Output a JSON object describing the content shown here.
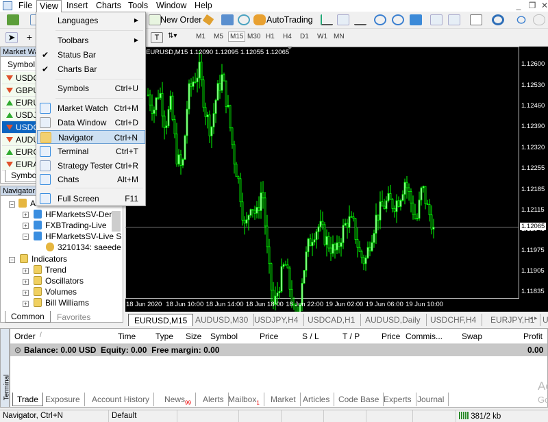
{
  "menubar": {
    "items": [
      "File",
      "View",
      "Insert",
      "Charts",
      "Tools",
      "Window",
      "Help"
    ]
  },
  "toolbar": {
    "new_order": "New Order",
    "autotrading": "AutoTrading",
    "timeframes": [
      "M1",
      "M5",
      "M15",
      "M30",
      "H1",
      "H4",
      "D1",
      "W1",
      "MN"
    ],
    "active_timeframe": "M15"
  },
  "view_menu": {
    "items": [
      {
        "label": "Languages",
        "shortcut": "",
        "submenu": true
      },
      {
        "label": "Toolbars",
        "shortcut": "",
        "submenu": true
      },
      {
        "label": "Status Bar",
        "shortcut": "",
        "checked": true
      },
      {
        "label": "Charts Bar",
        "shortcut": "",
        "checked": true
      },
      {
        "label": "Symbols",
        "shortcut": "Ctrl+U"
      },
      {
        "label": "Market Watch",
        "shortcut": "Ctrl+M"
      },
      {
        "label": "Data Window",
        "shortcut": "Ctrl+D"
      },
      {
        "label": "Navigator",
        "shortcut": "Ctrl+N",
        "highlighted": true
      },
      {
        "label": "Terminal",
        "shortcut": "Ctrl+T"
      },
      {
        "label": "Strategy Tester",
        "shortcut": "Ctrl+R"
      },
      {
        "label": "Chats",
        "shortcut": "Alt+M"
      },
      {
        "label": "Full Screen",
        "shortcut": "F11"
      }
    ]
  },
  "market_watch": {
    "title": "Market Watch",
    "column": "Symbol",
    "tab": "Symbols",
    "rows": [
      {
        "symbol": "USDCHF",
        "dir": "down"
      },
      {
        "symbol": "GBPUSD",
        "dir": "down"
      },
      {
        "symbol": "EURUSD",
        "dir": "up"
      },
      {
        "symbol": "USDJPY",
        "dir": "up"
      },
      {
        "symbol": "USDCAD",
        "dir": "down",
        "selected": true
      },
      {
        "symbol": "AUDUSD",
        "dir": "down"
      },
      {
        "symbol": "EURGBP",
        "dir": "up"
      },
      {
        "symbol": "EURAUD",
        "dir": "down"
      }
    ]
  },
  "navigator": {
    "title": "Navigator",
    "accounts": "Accounts",
    "servers": [
      "HFMarketsSV-Demo",
      "FXBTrading-Live",
      "HFMarketsSV-Live S"
    ],
    "account": "3210134: saeede",
    "indicators": "Indicators",
    "indicator_groups": [
      "Trend",
      "Oscillators",
      "Volumes",
      "Bill Williams"
    ],
    "tabs": [
      "Common",
      "Favorites"
    ]
  },
  "chart": {
    "header": "EURUSD,M15  1.12090 1.12095 1.12055 1.12065",
    "price_ticks": [
      "1.12600",
      "1.12530",
      "1.12460",
      "1.12390",
      "1.12320",
      "1.12255",
      "1.12185",
      "1.12115",
      "1.12045",
      "1.11975",
      "1.11905",
      "1.11835"
    ],
    "current_price": "1.12065",
    "time_ticks": [
      "18 Jun 2020",
      "18 Jun 10:00",
      "18 Jun 14:00",
      "18 Jun 18:00",
      "18 Jun 22:00",
      "19 Jun 02:00",
      "19 Jun 06:00",
      "19 Jun 10:00"
    ],
    "closes": [
      1.125,
      1.1245,
      1.1252,
      1.124,
      1.1247,
      1.123,
      1.1225,
      1.125,
      1.1255,
      1.1258,
      1.1245,
      1.1238,
      1.125,
      1.1256,
      1.1245,
      1.123,
      1.122,
      1.1205,
      1.1215,
      1.121,
      1.122,
      1.1195,
      1.118,
      1.1188,
      1.1195,
      1.1185,
      1.1173,
      1.119,
      1.12,
      1.1205,
      1.1207,
      1.1203,
      1.12,
      1.1198,
      1.1205,
      1.1209,
      1.1207,
      1.1198,
      1.1195,
      1.1203,
      1.121,
      1.1213,
      1.1215,
      1.1214,
      1.1216,
      1.1222,
      1.1215,
      1.1208,
      1.122,
      1.1212,
      1.1207
    ],
    "candle_color": "#00ff00",
    "tabs": [
      "EURUSD,M15",
      "AUDUSD,M30",
      "USDJPY,H4",
      "USDCAD,H1",
      "AUDUSD,Daily",
      "USDCHF,H4",
      "EURJPY,H1",
      "USI"
    ]
  },
  "terminal": {
    "side_label": "Terminal",
    "columns": [
      "Order",
      "/",
      "Time",
      "Type",
      "Size",
      "Symbol",
      "Price",
      "S / L",
      "T / P",
      "Price",
      "Commis...",
      "Swap",
      "Profit"
    ],
    "balance": "Balance: 0.00 USD  Equity: 0.00  Free margin: 0.00",
    "profit": "0.00",
    "tabs": [
      {
        "label": "Trade"
      },
      {
        "label": "Exposure"
      },
      {
        "label": "Account History"
      },
      {
        "label": "News",
        "badge": "99"
      },
      {
        "label": "Alerts"
      },
      {
        "label": "Mailbox",
        "badge": "1"
      },
      {
        "label": "Market"
      },
      {
        "label": "Articles"
      },
      {
        "label": "Code Base"
      },
      {
        "label": "Experts"
      },
      {
        "label": "Journal"
      }
    ]
  },
  "watermark": {
    "line1": "Activ",
    "line2": "Go to S"
  },
  "statusbar": {
    "hint": "Navigator, Ctrl+N",
    "profile": "Default",
    "traffic": "381/2 kb"
  }
}
